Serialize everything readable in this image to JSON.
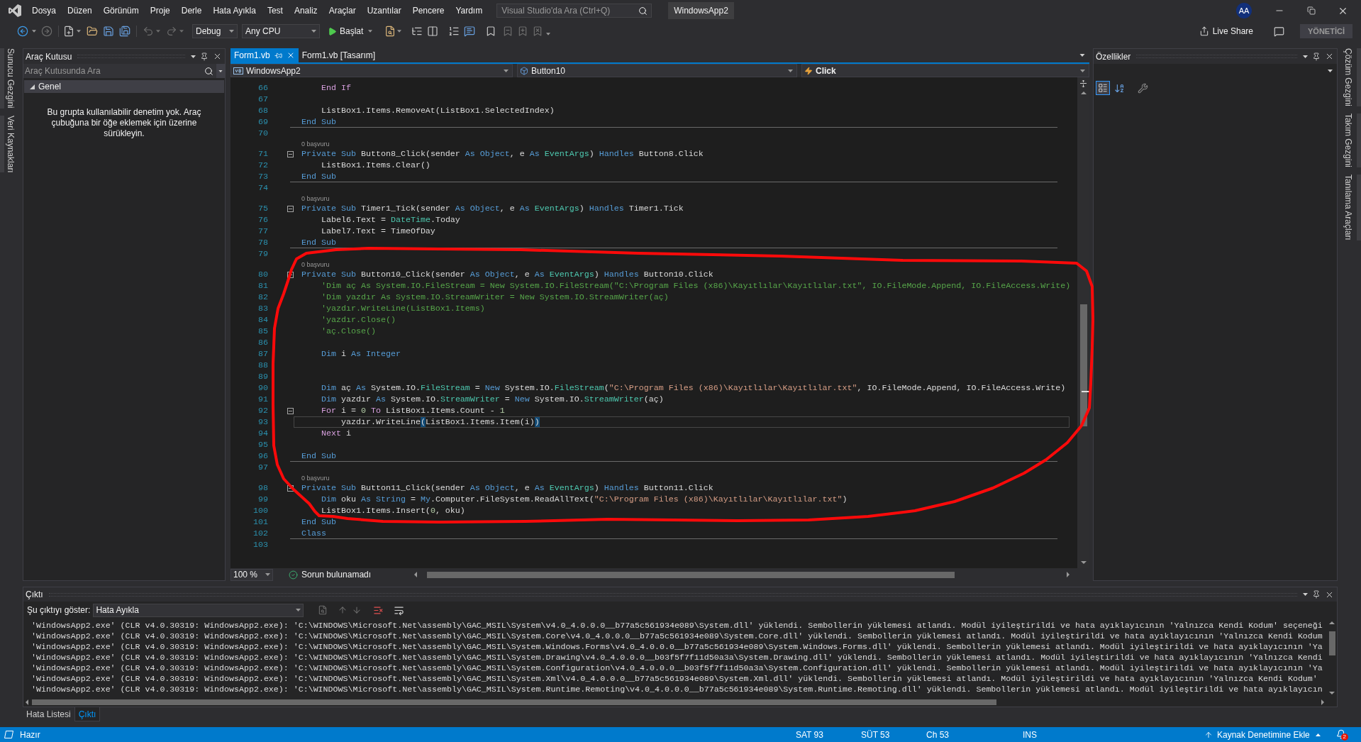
{
  "menu_bar": {
    "items": [
      "Dosya",
      "Düzen",
      "Görünüm",
      "Proje",
      "Derle",
      "Hata Ayıkla",
      "Test",
      "Analiz",
      "Araçlar",
      "Uzantılar",
      "Pencere",
      "Yardım"
    ],
    "search": {
      "placeholder": "Visual Studio'da Ara (Ctrl+Q)"
    },
    "solution": "WindowsApp2",
    "account": "AA"
  },
  "toolbar": {
    "configuration": "Debug",
    "platform": "Any CPU",
    "start": "Başlat",
    "live_share": "Live Share",
    "role_badge": "YÖNETİCİ"
  },
  "left_side_tabs": [
    "Sunucu Gezgini",
    "Veri Kaynakları"
  ],
  "toolbox": {
    "title": "Araç Kutusu",
    "search": {
      "placeholder": "Araç Kutusunda Ara"
    },
    "groups": [
      {
        "label": "Genel",
        "expanded": true,
        "empty_message": "Bu grupta kullanılabilir denetim yok. Araç çubuğuna bir öğe eklemek için üzerine sürükleyin."
      }
    ]
  },
  "editor": {
    "tabs": [
      {
        "label": "Form1.vb",
        "selected": true
      },
      {
        "label": "Form1.vb [Tasarım]",
        "selected": false
      }
    ],
    "navigation": {
      "project": "WindowsApp2",
      "object": "Button10",
      "member": "Click"
    },
    "lines": [
      {
        "number": "66",
        "tokens": [
          {
            "text": "    End If",
            "kind": "control"
          }
        ],
        "fold": false,
        "separator": false,
        "current": false
      },
      {
        "number": "67",
        "fold": false,
        "separator": false,
        "current": false
      },
      {
        "number": "68",
        "tokens": [
          {
            "text": "    ListBox1.Items.RemoveAt(ListBox1.SelectedIndex)",
            "kind": "plain"
          }
        ],
        "fold": false,
        "separator": false,
        "current": false
      },
      {
        "number": "69",
        "tokens": [
          {
            "text": "End Sub",
            "kind": "keyword"
          }
        ],
        "fold": false,
        "separator": true,
        "current": false
      },
      {
        "number": "70",
        "fold": false,
        "separator": false,
        "current": false
      },
      {
        "number": "71",
        "codelens": "0 başvuru",
        "tokens": [
          {
            "text": "Private Sub",
            "kind": "keyword"
          },
          {
            "text": " Button8_Click(sender ",
            "kind": "plain"
          },
          {
            "text": "As Object",
            "kind": "keyword"
          },
          {
            "text": ", e ",
            "kind": "plain"
          },
          {
            "text": "As ",
            "kind": "keyword"
          },
          {
            "text": "EventArgs",
            "kind": "type"
          },
          {
            "text": ") ",
            "kind": "plain"
          },
          {
            "text": "Handles",
            "kind": "keyword"
          },
          {
            "text": " Button8.Click",
            "kind": "plain"
          }
        ],
        "fold": true,
        "separator": false,
        "current": false
      },
      {
        "number": "72",
        "tokens": [
          {
            "text": "    ListBox1.Items.Clear()",
            "kind": "plain"
          }
        ],
        "fold": false,
        "separator": false,
        "current": false
      },
      {
        "number": "73",
        "tokens": [
          {
            "text": "End Sub",
            "kind": "keyword"
          }
        ],
        "fold": false,
        "separator": true,
        "current": false
      },
      {
        "number": "74",
        "fold": false,
        "separator": false,
        "current": false
      },
      {
        "number": "75",
        "codelens": "0 başvuru",
        "tokens": [
          {
            "text": "Private Sub",
            "kind": "keyword"
          },
          {
            "text": " Timer1_Tick(sender ",
            "kind": "plain"
          },
          {
            "text": "As Object",
            "kind": "keyword"
          },
          {
            "text": ", e ",
            "kind": "plain"
          },
          {
            "text": "As ",
            "kind": "keyword"
          },
          {
            "text": "EventArgs",
            "kind": "type"
          },
          {
            "text": ") ",
            "kind": "plain"
          },
          {
            "text": "Handles",
            "kind": "keyword"
          },
          {
            "text": " Timer1.Tick",
            "kind": "plain"
          }
        ],
        "fold": true,
        "separator": false,
        "current": false
      },
      {
        "number": "76",
        "tokens": [
          {
            "text": "    Label6.Text = ",
            "kind": "plain"
          },
          {
            "text": "DateTime",
            "kind": "type"
          },
          {
            "text": ".Today",
            "kind": "plain"
          }
        ],
        "fold": false,
        "separator": false,
        "current": false
      },
      {
        "number": "77",
        "tokens": [
          {
            "text": "    Label7.Text = TimeOfDay",
            "kind": "plain"
          }
        ],
        "fold": false,
        "separator": false,
        "current": false
      },
      {
        "number": "78",
        "tokens": [
          {
            "text": "End Sub",
            "kind": "keyword"
          }
        ],
        "fold": false,
        "separator": true,
        "current": false
      },
      {
        "number": "79",
        "fold": false,
        "separator": false,
        "current": false
      },
      {
        "number": "80",
        "codelens": "0 başvuru",
        "tokens": [
          {
            "text": "Private Sub",
            "kind": "keyword"
          },
          {
            "text": " Button10_Click(sender ",
            "kind": "plain"
          },
          {
            "text": "As Object",
            "kind": "keyword"
          },
          {
            "text": ", e ",
            "kind": "plain"
          },
          {
            "text": "As ",
            "kind": "keyword"
          },
          {
            "text": "EventArgs",
            "kind": "type"
          },
          {
            "text": ") ",
            "kind": "plain"
          },
          {
            "text": "Handles",
            "kind": "keyword"
          },
          {
            "text": " Button10.Click",
            "kind": "plain"
          }
        ],
        "fold": true,
        "separator": false,
        "current": false
      },
      {
        "number": "81",
        "tokens": [
          {
            "text": "    'Dim aç As System.IO.FileStream = New System.IO.FileStream(\"C:\\Program Files (x86)\\Kayıtlılar\\Kayıtlılar.txt\", IO.FileMode.Append, IO.FileAccess.Write)",
            "kind": "comment"
          }
        ],
        "fold": false,
        "separator": false,
        "current": false
      },
      {
        "number": "82",
        "tokens": [
          {
            "text": "    'Dim yazdır As System.IO.StreamWriter = New System.IO.StreamWriter(aç)",
            "kind": "comment"
          }
        ],
        "fold": false,
        "separator": false,
        "current": false
      },
      {
        "number": "83",
        "tokens": [
          {
            "text": "    'yazdır.WriteLine(ListBox1.Items)",
            "kind": "comment"
          }
        ],
        "fold": false,
        "separator": false,
        "current": false
      },
      {
        "number": "84",
        "tokens": [
          {
            "text": "    'yazdır.Close()",
            "kind": "comment"
          }
        ],
        "fold": false,
        "separator": false,
        "current": false
      },
      {
        "number": "85",
        "tokens": [
          {
            "text": "    'aç.Close()",
            "kind": "comment"
          }
        ],
        "fold": false,
        "separator": false,
        "current": false
      },
      {
        "number": "86",
        "fold": false,
        "separator": false,
        "current": false
      },
      {
        "number": "87",
        "tokens": [
          {
            "text": "    Dim",
            "kind": "keyword"
          },
          {
            "text": " i ",
            "kind": "plain"
          },
          {
            "text": "As Integer",
            "kind": "keyword"
          }
        ],
        "fold": false,
        "separator": false,
        "current": false
      },
      {
        "number": "88",
        "fold": false,
        "separator": false,
        "current": false
      },
      {
        "number": "89",
        "fold": false,
        "separator": false,
        "current": false
      },
      {
        "number": "90",
        "tokens": [
          {
            "text": "    Dim",
            "kind": "keyword"
          },
          {
            "text": " aç ",
            "kind": "plain"
          },
          {
            "text": "As",
            "kind": "keyword"
          },
          {
            "text": " System.IO.",
            "kind": "plain"
          },
          {
            "text": "FileStream",
            "kind": "type"
          },
          {
            "text": " = ",
            "kind": "plain"
          },
          {
            "text": "New",
            "kind": "keyword"
          },
          {
            "text": " System.IO.",
            "kind": "plain"
          },
          {
            "text": "FileStream",
            "kind": "type"
          },
          {
            "text": "(",
            "kind": "plain"
          },
          {
            "text": "\"C:\\Program Files (x86)\\Kayıtlılar\\Kayıtlılar.txt\"",
            "kind": "string"
          },
          {
            "text": ", IO.FileMode.Append, IO.FileAccess.Write)",
            "kind": "plain"
          }
        ],
        "fold": false,
        "separator": false,
        "current": false
      },
      {
        "number": "91",
        "tokens": [
          {
            "text": "    Dim",
            "kind": "keyword"
          },
          {
            "text": " yazdır ",
            "kind": "plain"
          },
          {
            "text": "As",
            "kind": "keyword"
          },
          {
            "text": " System.IO.",
            "kind": "plain"
          },
          {
            "text": "StreamWriter",
            "kind": "type"
          },
          {
            "text": " = ",
            "kind": "plain"
          },
          {
            "text": "New",
            "kind": "keyword"
          },
          {
            "text": " System.IO.",
            "kind": "plain"
          },
          {
            "text": "StreamWriter",
            "kind": "type"
          },
          {
            "text": "(aç)",
            "kind": "plain"
          }
        ],
        "fold": false,
        "separator": false,
        "current": false
      },
      {
        "number": "92",
        "tokens": [
          {
            "text": "    For",
            "kind": "control"
          },
          {
            "text": " i = ",
            "kind": "plain"
          },
          {
            "text": "0",
            "kind": "number"
          },
          {
            "text": " To",
            "kind": "control"
          },
          {
            "text": " ListBox1.Items.Count - ",
            "kind": "plain"
          },
          {
            "text": "1",
            "kind": "number"
          }
        ],
        "fold": true,
        "separator": false,
        "current": false
      },
      {
        "number": "93",
        "tokens": [
          {
            "text": "        yazdır.WriteLine",
            "kind": "plain"
          },
          {
            "text": "(",
            "kind": "brace"
          },
          {
            "text": "ListBox1.Items.Item(i)",
            "kind": "plain"
          },
          {
            "text": ")",
            "kind": "brace"
          }
        ],
        "fold": false,
        "separator": false,
        "current": true
      },
      {
        "number": "94",
        "tokens": [
          {
            "text": "    Next",
            "kind": "control"
          },
          {
            "text": " i",
            "kind": "plain"
          }
        ],
        "fold": false,
        "separator": false,
        "current": false
      },
      {
        "number": "95",
        "fold": false,
        "separator": false,
        "current": false
      },
      {
        "number": "96",
        "tokens": [
          {
            "text": "End Sub",
            "kind": "keyword"
          }
        ],
        "fold": false,
        "separator": true,
        "current": false
      },
      {
        "number": "97",
        "fold": false,
        "separator": false,
        "current": false
      },
      {
        "number": "98",
        "codelens": "0 başvuru",
        "tokens": [
          {
            "text": "Private Sub",
            "kind": "keyword"
          },
          {
            "text": " Button11_Click(sender ",
            "kind": "plain"
          },
          {
            "text": "As Object",
            "kind": "keyword"
          },
          {
            "text": ", e ",
            "kind": "plain"
          },
          {
            "text": "As ",
            "kind": "keyword"
          },
          {
            "text": "EventArgs",
            "kind": "type"
          },
          {
            "text": ") ",
            "kind": "plain"
          },
          {
            "text": "Handles",
            "kind": "keyword"
          },
          {
            "text": " Button11.Click",
            "kind": "plain"
          }
        ],
        "fold": true,
        "separator": false,
        "current": false
      },
      {
        "number": "99",
        "tokens": [
          {
            "text": "    Dim",
            "kind": "keyword"
          },
          {
            "text": " oku ",
            "kind": "plain"
          },
          {
            "text": "As String",
            "kind": "keyword"
          },
          {
            "text": " = ",
            "kind": "plain"
          },
          {
            "text": "My",
            "kind": "keyword"
          },
          {
            "text": ".Computer.FileSystem.ReadAllText(",
            "kind": "plain"
          },
          {
            "text": "\"C:\\Program Files (x86)\\Kayıtlılar\\Kayıtlılar.txt\"",
            "kind": "string"
          },
          {
            "text": ")",
            "kind": "plain"
          }
        ],
        "fold": false,
        "separator": false,
        "current": false
      },
      {
        "number": "100",
        "tokens": [
          {
            "text": "    ListBox1.Items.Insert(",
            "kind": "plain"
          },
          {
            "text": "0",
            "kind": "number"
          },
          {
            "text": ", oku)",
            "kind": "plain"
          }
        ],
        "fold": false,
        "separator": false,
        "current": false
      },
      {
        "number": "101",
        "tokens": [
          {
            "text": "End Sub",
            "kind": "keyword"
          }
        ],
        "fold": false,
        "separator": false,
        "current": false
      },
      {
        "number": "102",
        "tokens": [
          {
            "text": "Class",
            "kind": "keyword"
          }
        ],
        "fold": false,
        "separator": true,
        "current": false
      },
      {
        "number": "103",
        "fold": false,
        "separator": false,
        "current": false
      }
    ],
    "zoom": "100 %",
    "health": "Sorun bulunamadı"
  },
  "properties": {
    "title": "Özellikler"
  },
  "right_side_tabs": [
    "Çözüm Gezgini",
    "Takım Gezgini",
    "Tanılama Araçları"
  ],
  "output": {
    "title": "Çıktı",
    "source_label": "Şu çıktıyı göster:",
    "source": "Hata Ayıkla",
    "lines": [
      "'WindowsApp2.exe' (CLR v4.0.30319: WindowsApp2.exe): 'C:\\WINDOWS\\Microsoft.Net\\assembly\\GAC_MSIL\\System\\v4.0_4.0.0.0__b77a5c561934e089\\System.dll' yüklendi. Sembollerin yüklemesi atlandı. Modül iyileştirildi ve hata ayıklayıcının 'Yalnızca Kendi Kodum' seçeneği",
      "'WindowsApp2.exe' (CLR v4.0.30319: WindowsApp2.exe): 'C:\\WINDOWS\\Microsoft.Net\\assembly\\GAC_MSIL\\System.Core\\v4.0_4.0.0.0__b77a5c561934e089\\System.Core.dll' yüklendi. Sembollerin yüklemesi atlandı. Modül iyileştirildi ve hata ayıklayıcının 'Yalnızca Kendi Kodum",
      "'WindowsApp2.exe' (CLR v4.0.30319: WindowsApp2.exe): 'C:\\WINDOWS\\Microsoft.Net\\assembly\\GAC_MSIL\\System.Windows.Forms\\v4.0_4.0.0.0__b77a5c561934e089\\System.Windows.Forms.dll' yüklendi. Sembollerin yüklemesi atlandı. Modül iyileştirildi ve hata ayıklayıcının 'Ya",
      "'WindowsApp2.exe' (CLR v4.0.30319: WindowsApp2.exe): 'C:\\WINDOWS\\Microsoft.Net\\assembly\\GAC_MSIL\\System.Drawing\\v4.0_4.0.0.0__b03f5f7f11d50a3a\\System.Drawing.dll' yüklendi. Sembollerin yüklemesi atlandı. Modül iyileştirildi ve hata ayıklayıcının 'Yalnızca Kendi",
      "'WindowsApp2.exe' (CLR v4.0.30319: WindowsApp2.exe): 'C:\\WINDOWS\\Microsoft.Net\\assembly\\GAC_MSIL\\System.Configuration\\v4.0_4.0.0.0__b03f5f7f11d50a3a\\System.Configuration.dll' yüklendi. Sembollerin yüklemesi atlandı. Modül iyileştirildi ve hata ayıklayıcının 'Ya",
      "'WindowsApp2.exe' (CLR v4.0.30319: WindowsApp2.exe): 'C:\\WINDOWS\\Microsoft.Net\\assembly\\GAC_MSIL\\System.Xml\\v4.0_4.0.0.0__b77a5c561934e089\\System.Xml.dll' yüklendi. Sembollerin yüklemesi atlandı. Modül iyileştirildi ve hata ayıklayıcının 'Yalnızca Kendi Kodum'",
      "'WindowsApp2.exe' (CLR v4.0.30319: WindowsApp2.exe): 'C:\\WINDOWS\\Microsoft.Net\\assembly\\GAC_MSIL\\System.Runtime.Remoting\\v4.0_4.0.0.0__b77a5c561934e089\\System.Runtime.Remoting.dll' yüklendi. Sembollerin yüklemesi atlandı. Modül iyileştirildi ve hata ayıklayıcın"
    ]
  },
  "bottom_tabs": [
    {
      "label": "Hata Listesi",
      "selected": false
    },
    {
      "label": "Çıktı",
      "selected": true
    }
  ],
  "status_bar": {
    "message": "Hazır",
    "line": "SAT 93",
    "column": "SÜT 53",
    "char": "Ch 53",
    "mode": "INS",
    "source_control": "Kaynak Denetimine Ekle",
    "notifications": "2"
  }
}
